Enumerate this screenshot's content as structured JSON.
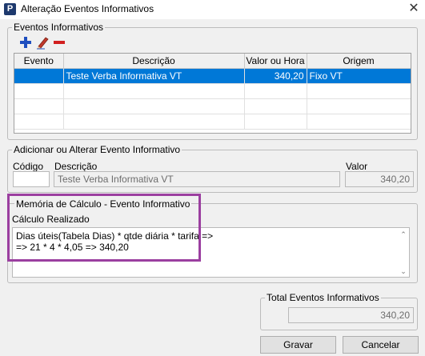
{
  "window": {
    "title": "Alteração Eventos Informativos",
    "close_glyph": "✕"
  },
  "eventos": {
    "group_label": "Eventos Informativos",
    "toolbar": {
      "add_icon": "plus-icon",
      "edit_icon": "pencil-icon",
      "remove_icon": "minus-icon",
      "colors": {
        "add": "#1f4fbf",
        "remove": "#d11f1f"
      }
    },
    "columns": [
      "Evento",
      "Descrição",
      "Valor ou Hora",
      "Origem"
    ],
    "rows": [
      {
        "evento": "",
        "descricao": "Teste Verba Informativa VT",
        "valor": "340,20",
        "origem": "Fixo VT",
        "selected": true
      }
    ]
  },
  "form": {
    "group_label": "Adicionar ou Alterar Evento Informativo",
    "codigo_label": "Código",
    "codigo_value": "",
    "descricao_label": "Descrição",
    "descricao_value": "Teste Verba Informativa VT",
    "valor_label": "Valor",
    "valor_value": "340,20"
  },
  "memoria": {
    "group_label": "Memória de Cálculo - Evento Informativo",
    "calc_label": "Cálculo Realizado",
    "calc_text": "Dias úteis(Tabela Dias) * qtde diária * tarifa =>\n=> 21 * 4 * 4,05 => 340,20",
    "highlight_color": "#9b3fa0"
  },
  "total": {
    "group_label": "Total Eventos Informativos",
    "value": "340,20"
  },
  "buttons": {
    "gravar": "Gravar",
    "cancelar": "Cancelar"
  }
}
